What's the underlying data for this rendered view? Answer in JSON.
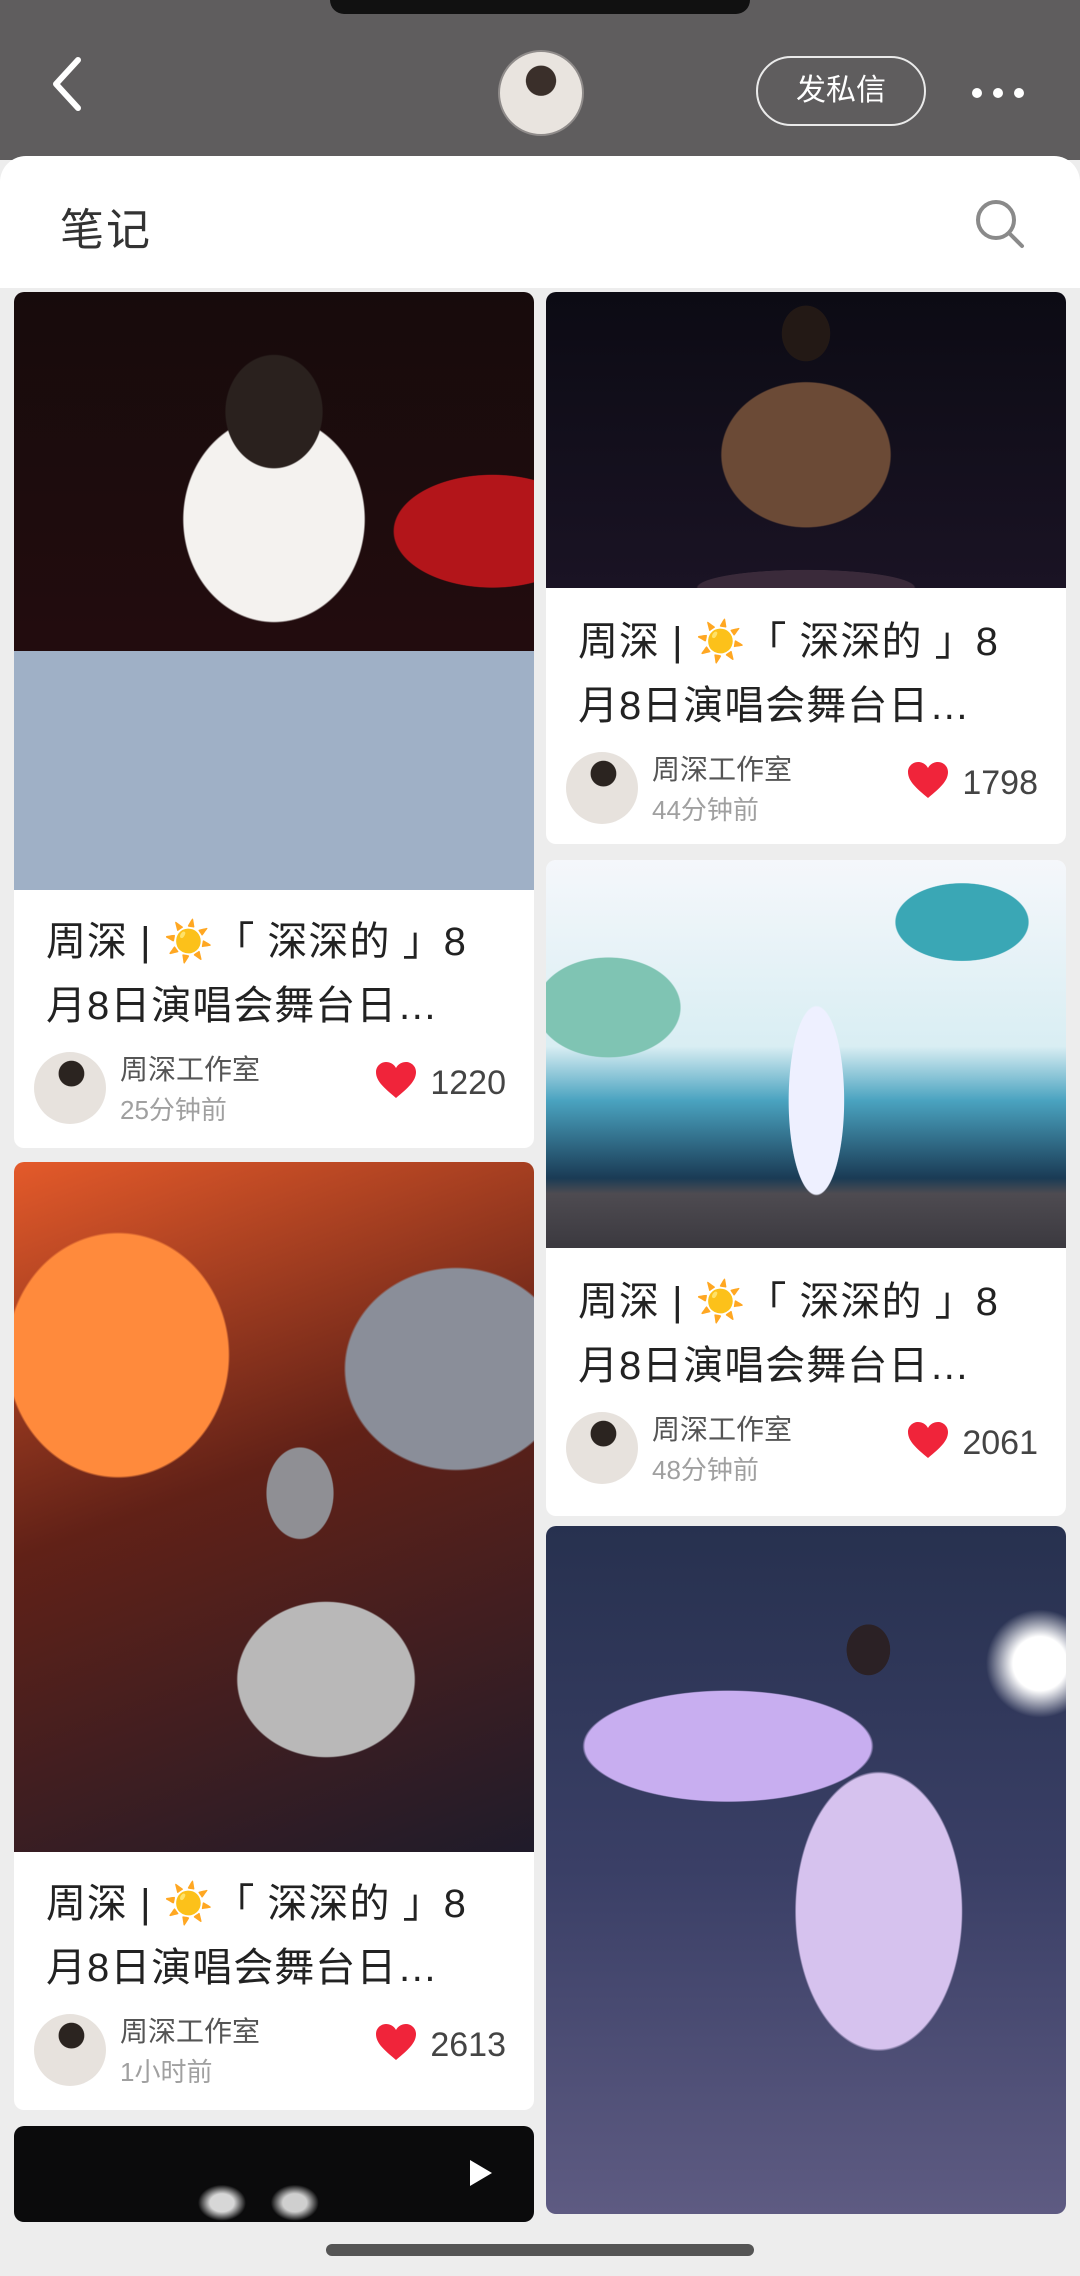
{
  "header": {
    "dm_label": "发私信",
    "icons": {
      "back": "chevron-left-icon",
      "more": "more-dots-icon",
      "search": "search-icon"
    }
  },
  "section": {
    "title": "笔记"
  },
  "posts": [
    {
      "title_prefix": "周深 | ",
      "title_rest": "「 深深的 」8月8日演唱会舞台日…",
      "title_line1": "周深 | ☀️「 深深的 」8",
      "title_line2": "月8日演唱会舞台日…",
      "author": "周深工作室",
      "time": "25分钟前",
      "likes": "1220"
    },
    {
      "title_line1": "周深 | ☀️「 深深的 」8",
      "title_line2": "月8日演唱会舞台日…",
      "author": "周深工作室",
      "time": "44分钟前",
      "likes": "1798"
    },
    {
      "title_line1": "周深 | ☀️「 深深的 」8",
      "title_line2": "月8日演唱会舞台日…",
      "author": "周深工作室",
      "time": "1小时前",
      "likes": "2613"
    },
    {
      "title_line1": "周深 | ☀️「 深深的 」8",
      "title_line2": "月8日演唱会舞台日…",
      "author": "周深工作室",
      "time": "48分钟前",
      "likes": "2061"
    }
  ],
  "colors": {
    "like_heart": "#f0243a",
    "topbar": "#5f5d5e"
  }
}
